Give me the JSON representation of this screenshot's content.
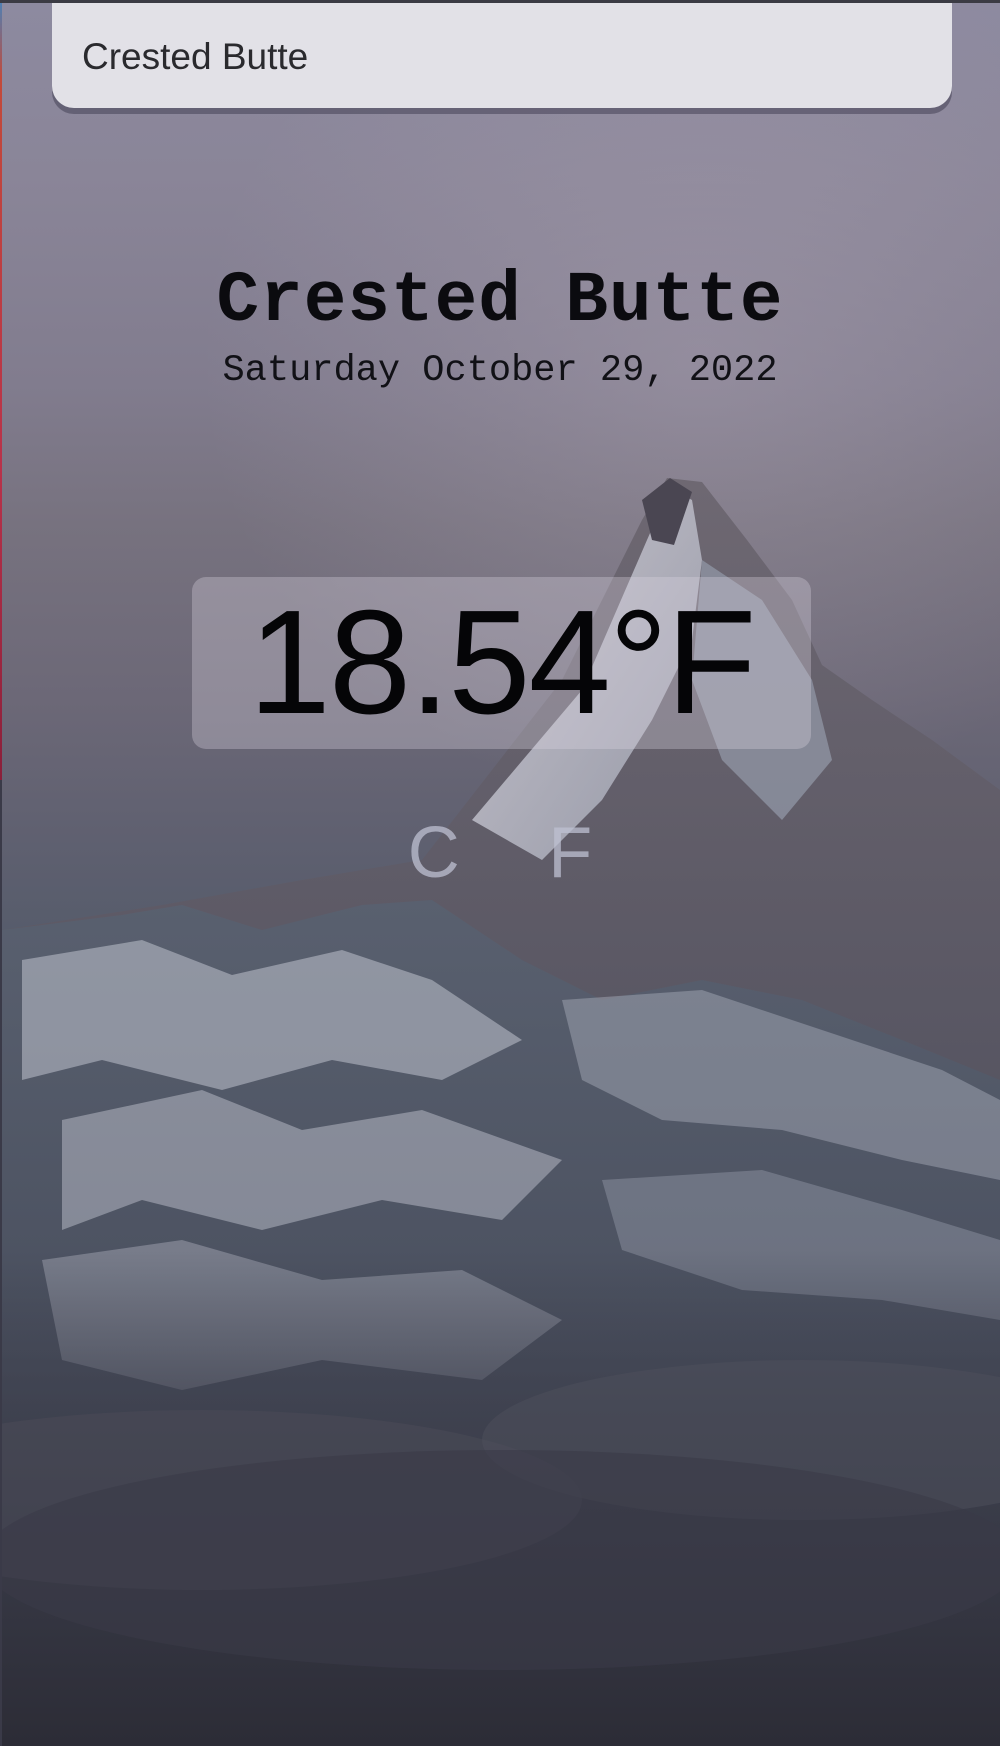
{
  "search": {
    "value": "Crested Butte",
    "placeholder": ""
  },
  "weather": {
    "city": "Crested Butte",
    "date": "Saturday October 29, 2022",
    "temperature": "18.54°F"
  },
  "units": {
    "celsius_label": "C",
    "fahrenheit_label": "F"
  },
  "background": {
    "icon": "mountain-photo"
  }
}
